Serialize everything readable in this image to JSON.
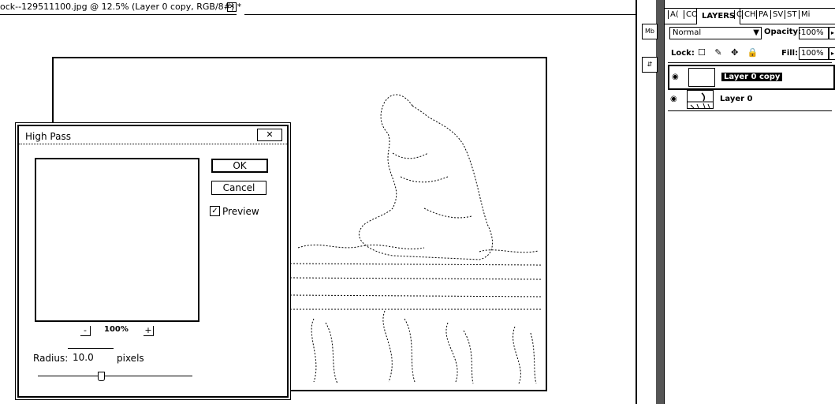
{
  "document": {
    "tab_title": "ock--129511100.jpg @ 12.5% (Layer 0 copy, RGB/8#) *",
    "close_glyph": "✕"
  },
  "dialog": {
    "title": "High Pass",
    "close_glyph": "✕",
    "ok_label": "OK",
    "cancel_label": "Cancel",
    "preview_label": "Preview",
    "preview_checked": true,
    "check_glyph": "✓",
    "zoom_minus": "-",
    "zoom_plus": "+",
    "zoom_level": "100%",
    "radius_label": "Radius:",
    "radius_value": "10.0",
    "radius_unit": "pixels"
  },
  "dock": {
    "icon1": "Mb",
    "icon2": "⇵"
  },
  "layers_panel": {
    "tabs": [
      "A(",
      "CO",
      "LAYERS",
      "C",
      "CH",
      "PA",
      "SV",
      "ST",
      "Mi"
    ],
    "active_tab": "LAYERS",
    "blend_mode": "Normal",
    "dropdown_glyph": "▼",
    "opacity_label": "Opacity:",
    "opacity_value": "100%",
    "lock_label": "Lock:",
    "lock_icons": "☐ ✎ ✥ 🔒",
    "fill_label": "Fill:",
    "fill_value": "100%",
    "spin_glyph": "▸",
    "eye_glyph": "◉",
    "layers": [
      {
        "name": "Layer 0 copy",
        "selected": true
      },
      {
        "name": "Layer 0",
        "selected": false
      }
    ]
  }
}
